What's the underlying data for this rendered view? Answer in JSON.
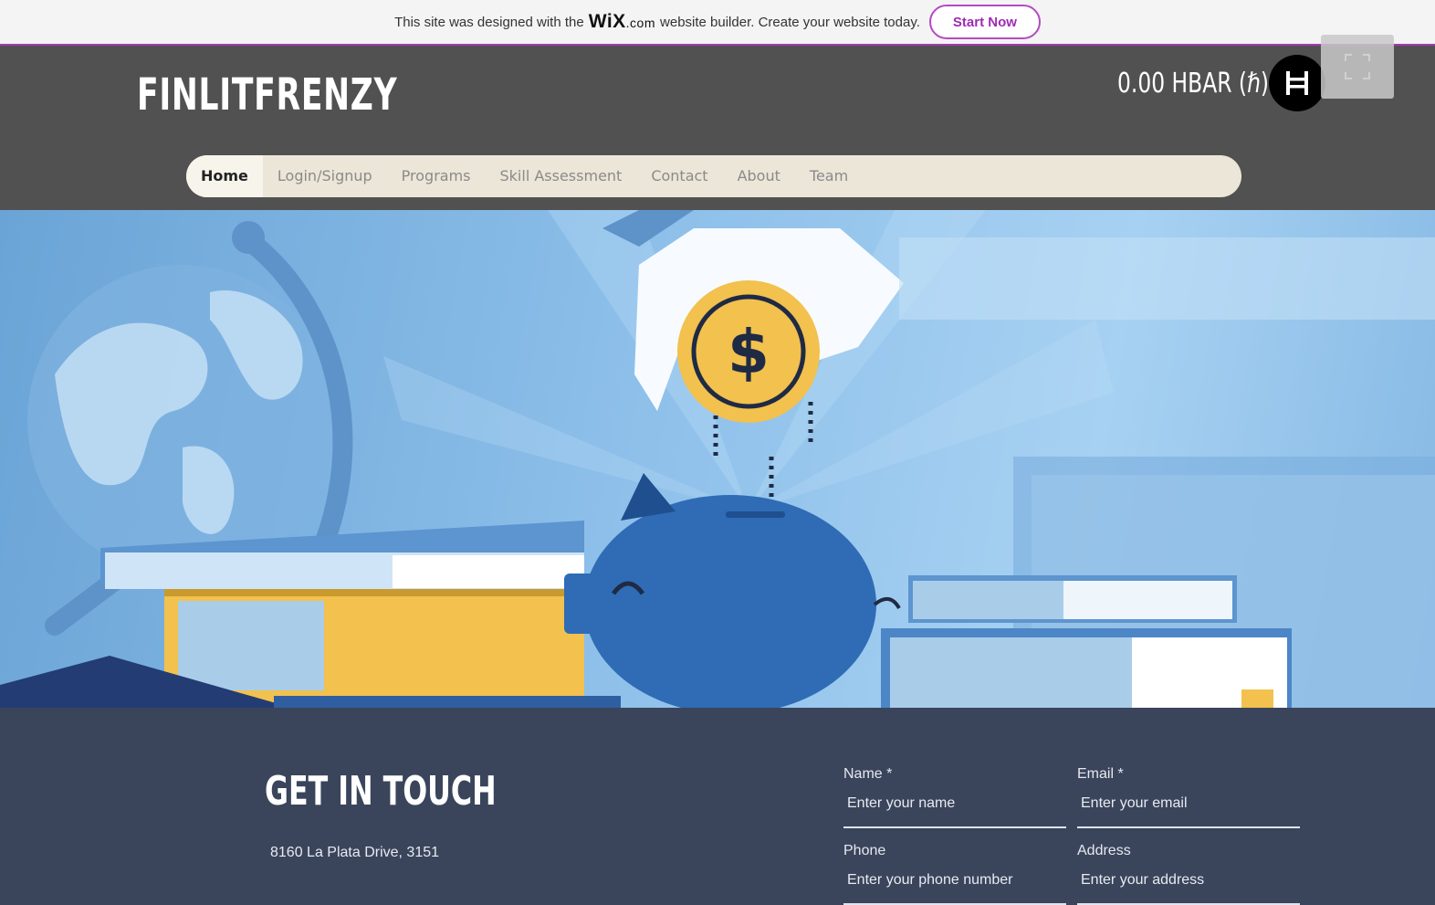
{
  "banner": {
    "text_before": "This site was designed with the",
    "brand": "WiX",
    "brand_suffix": ".com",
    "text_after": "website builder. Create your website today.",
    "cta_label": "Start Now"
  },
  "header": {
    "site_title": "FINLITFRENZY",
    "balance": "0.00 HBAR (ℏ)",
    "hbar_icon": "hbar-logo-icon",
    "fullscreen_icon": "fullscreen-icon"
  },
  "nav": {
    "items": [
      {
        "label": "Home",
        "active": true
      },
      {
        "label": "Login/Signup"
      },
      {
        "label": "Programs"
      },
      {
        "label": "Skill Assessment"
      },
      {
        "label": "Contact"
      },
      {
        "label": "About"
      },
      {
        "label": "Team"
      }
    ]
  },
  "hero": {
    "illustration": "piggy-bank-coin-books-globe",
    "coin_symbol": "$"
  },
  "contact": {
    "title": "GET IN TOUCH",
    "address": "8160 La Plata Drive, 3151",
    "fields": {
      "name": {
        "label": "Name *",
        "placeholder": "Enter your name"
      },
      "email": {
        "label": "Email *",
        "placeholder": "Enter your email"
      },
      "phone": {
        "label": "Phone",
        "placeholder": "Enter your phone number"
      },
      "address": {
        "label": "Address",
        "placeholder": "Enter your address"
      }
    }
  },
  "colors": {
    "banner_accent": "#a23ab0",
    "header_bg": "#515151",
    "nav_bg": "#ece6d8",
    "contact_bg": "#3a455c",
    "coin": "#f2c14e",
    "piggy": "#2f6cb5"
  }
}
